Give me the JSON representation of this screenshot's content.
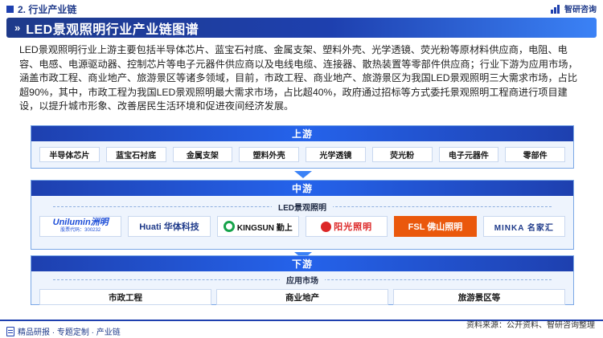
{
  "header": {
    "section_title": "2. 行业产业链",
    "brand_name": "智研咨询"
  },
  "banner": {
    "title": "LED景观照明行业产业链图谱"
  },
  "intro_text": "LED景观照明行业上游主要包括半导体芯片、蓝宝石衬底、金属支架、塑料外壳、光学透镜、荧光粉等原材料供应商，电阻、电容、电感、电源驱动器、控制芯片等电子元器件供应商以及电线电缆、连接器、散热装置等零部件供应商；行业下游为应用市场，涵盖市政工程、商业地产、旅游景区等诸多领域，目前，市政工程、商业地产、旅游景区为我国LED景观照明三大需求市场，占比超90%，其中，市政工程为我国LED景观照明最大需求市场，占比超40%，政府通过招标等方式委托景观照明工程商进行项目建设，以提升城市形象、改善居民生活环境和促进夜间经济发展。",
  "upstream": {
    "title": "上游",
    "items": [
      "半导体芯片",
      "蓝宝石衬底",
      "金属支架",
      "塑料外壳",
      "光学透镜",
      "荧光粉",
      "电子元器件",
      "零部件"
    ]
  },
  "midstream": {
    "title": "中游",
    "sub_label": "LED景观照明",
    "logos": [
      {
        "name": "Unilumin洲明",
        "sub": "股票代码：300232",
        "color": "#1d4ed8",
        "icon": "unilumin-logo"
      },
      {
        "name": "Huati 华体科技",
        "color": "#1e3a8a",
        "icon": "huati-logo"
      },
      {
        "name": "KINGSUN 勤上",
        "color": "#111111",
        "accent": "#16a34a",
        "icon": "kingsun-logo"
      },
      {
        "name": "阳光照明",
        "color": "#dc2626",
        "icon": "yankon-logo"
      },
      {
        "name": "FSL 佛山照明",
        "color": "#ea580c",
        "icon": "fsl-logo"
      },
      {
        "name": "MINKA 名家汇",
        "color": "#1e3a8a",
        "icon": "minka-logo"
      }
    ]
  },
  "downstream": {
    "title": "下游",
    "sub_label": "应用市场",
    "items": [
      "市政工程",
      "商业地产",
      "旅游景区等"
    ]
  },
  "footer": {
    "left_text": "精品研报 · 专题定制 · 产业链",
    "source_text": "资料来源：公开资料、智研咨询整理"
  },
  "colors": {
    "primary": "#1e40af",
    "tier_bg": "#eef4fd",
    "border": "#7aa7e6"
  }
}
